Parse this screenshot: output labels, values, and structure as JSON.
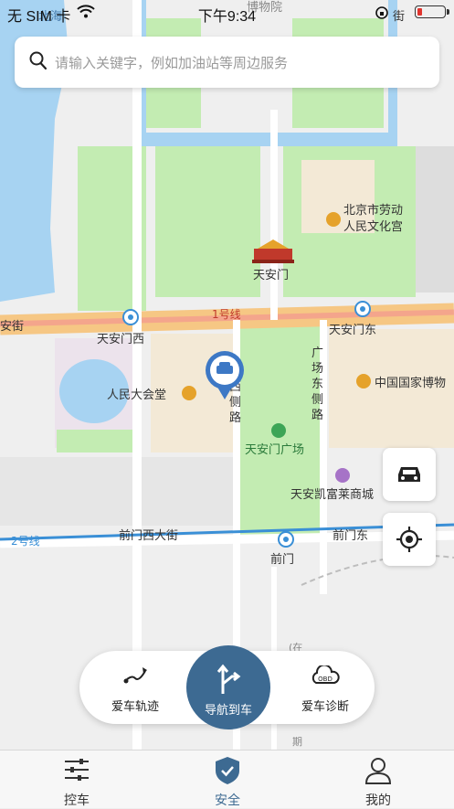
{
  "status": {
    "carrier": "无 SIM 卡",
    "time": "下午9:34",
    "battery_level": 0.2
  },
  "search": {
    "placeholder": "请输入关键字，例如加油站等周边服务"
  },
  "map": {
    "labels": {
      "bowuyuan": "博物院",
      "beihai": "北海",
      "jie_top": "街",
      "laodong": "北京市劳动",
      "laodong2": "人民文化宫",
      "tiananmen": "天安门",
      "line1": "1号线",
      "anjie": "安街",
      "tiananmen_west": "天安门西",
      "tiananmen_east": "天安门东",
      "great_hall": "人民大会堂",
      "west_side": "西侧路",
      "east_side": "广场东侧路",
      "museum": "中国国家博物",
      "square": "天安门广场",
      "kerry": "天安凯富莱商城",
      "line2": "2号线",
      "qianmen_west": "前门西大街",
      "qianmen_east": "前门东",
      "qianmen": "前门",
      "zai": "(在",
      "qi": "期"
    }
  },
  "actions": {
    "track": "爱车轨迹",
    "navigate": "导航到车",
    "diagnose": "爱车诊断",
    "obd": "OBD"
  },
  "tabs": [
    {
      "label": "控车"
    },
    {
      "label": "安全"
    },
    {
      "label": "我的"
    }
  ],
  "colors": {
    "accent": "#3d6a92",
    "subway_line1": "#e8544a",
    "subway_line2": "#3a8fd6",
    "water": "#a7d3f2",
    "green": "#c3ecb2"
  }
}
